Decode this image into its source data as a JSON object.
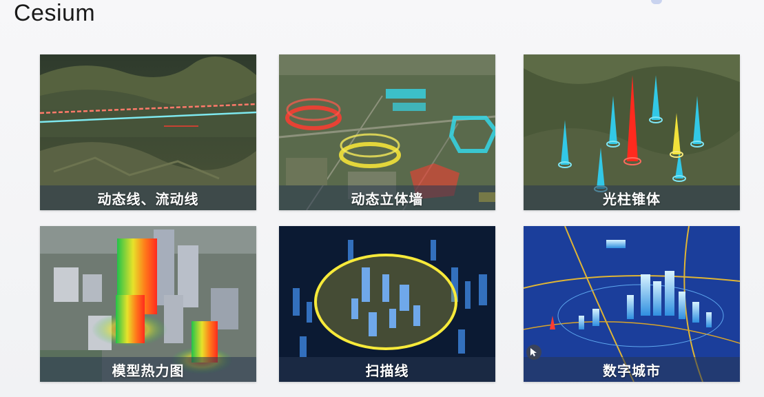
{
  "slide": {
    "title": "Cesium"
  },
  "tiles": [
    {
      "caption": "动态线、流动线",
      "icon": "terrain-flowline-scene"
    },
    {
      "caption": "动态立体墙",
      "icon": "dynamic-wall-scene"
    },
    {
      "caption": "光柱锥体",
      "icon": "light-cone-scene"
    },
    {
      "caption": "模型热力图",
      "icon": "model-heatmap-scene"
    },
    {
      "caption": "扫描线",
      "icon": "scanline-scene"
    },
    {
      "caption": "数字城市",
      "icon": "digital-city-scene"
    }
  ],
  "colors": {
    "caption_bar": "#283750",
    "wall_red": "#ff3b30",
    "wall_yellow": "#f2e23a",
    "wall_cyan": "#35d6e8",
    "cone_cyan": "#32c8e6",
    "city_blue": "#1b4fb8"
  }
}
